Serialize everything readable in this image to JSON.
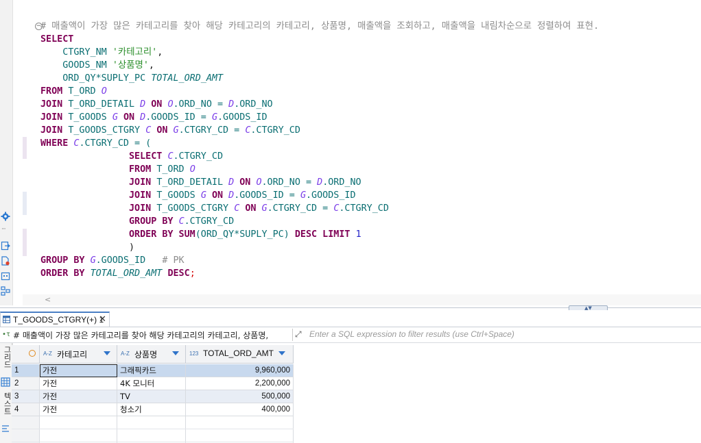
{
  "editor": {
    "lines": [
      [
        {
          "t": "# 매출액이 가장 많은 카테고리를 찾아 해당 카테고리의 카테고리, 상품명, 매출액을 조회하고, 매출액을 내림차순으로 정렬하여 표현.",
          "c": "cm"
        }
      ],
      [
        {
          "t": "SELECT",
          "c": "kw"
        }
      ],
      [
        {
          "t": "    CTGRY_NM ",
          "c": "col"
        },
        {
          "t": "'카테고리'",
          "c": "str"
        },
        {
          "t": ",",
          "c": ""
        }
      ],
      [
        {
          "t": "    GOODS_NM ",
          "c": "col"
        },
        {
          "t": "'상품명'",
          "c": "str"
        },
        {
          "t": ",",
          "c": ""
        }
      ],
      [
        {
          "t": "    ORD_QY*SUPLY_PC ",
          "c": "col"
        },
        {
          "t": "TOTAL_ORD_AMT",
          "c": "ital"
        }
      ],
      [
        {
          "t": "FROM ",
          "c": "kw"
        },
        {
          "t": "T_ORD ",
          "c": "col"
        },
        {
          "t": "O",
          "c": "al"
        }
      ],
      [
        {
          "t": "JOIN ",
          "c": "kw"
        },
        {
          "t": "T_ORD_DETAIL ",
          "c": "col"
        },
        {
          "t": "D ",
          "c": "al"
        },
        {
          "t": "ON ",
          "c": "kw"
        },
        {
          "t": "O",
          "c": "al"
        },
        {
          "t": ".ORD_NO = ",
          "c": "col"
        },
        {
          "t": "D",
          "c": "al"
        },
        {
          "t": ".ORD_NO",
          "c": "col"
        }
      ],
      [
        {
          "t": "JOIN ",
          "c": "kw"
        },
        {
          "t": "T_GOODS ",
          "c": "col"
        },
        {
          "t": "G ",
          "c": "al"
        },
        {
          "t": "ON ",
          "c": "kw"
        },
        {
          "t": "D",
          "c": "al"
        },
        {
          "t": ".GOODS_ID = ",
          "c": "col"
        },
        {
          "t": "G",
          "c": "al"
        },
        {
          "t": ".GOODS_ID",
          "c": "col"
        }
      ],
      [
        {
          "t": "JOIN ",
          "c": "kw"
        },
        {
          "t": "T_GOODS_CTGRY ",
          "c": "col"
        },
        {
          "t": "C ",
          "c": "al"
        },
        {
          "t": "ON ",
          "c": "kw"
        },
        {
          "t": "G",
          "c": "al"
        },
        {
          "t": ".CTGRY_CD = ",
          "c": "col"
        },
        {
          "t": "C",
          "c": "al"
        },
        {
          "t": ".CTGRY_CD",
          "c": "col"
        }
      ],
      [
        {
          "t": "WHERE ",
          "c": "kw"
        },
        {
          "t": "C",
          "c": "al"
        },
        {
          "t": ".CTGRY_CD = (",
          "c": "col"
        }
      ],
      [
        {
          "t": "                ",
          "c": ""
        },
        {
          "t": "SELECT ",
          "c": "kw"
        },
        {
          "t": "C",
          "c": "al"
        },
        {
          "t": ".CTGRY_CD",
          "c": "col"
        }
      ],
      [
        {
          "t": "                ",
          "c": ""
        },
        {
          "t": "FROM ",
          "c": "kw"
        },
        {
          "t": "T_ORD ",
          "c": "col"
        },
        {
          "t": "O",
          "c": "al"
        }
      ],
      [
        {
          "t": "                ",
          "c": ""
        },
        {
          "t": "JOIN ",
          "c": "kw"
        },
        {
          "t": "T_ORD_DETAIL ",
          "c": "col"
        },
        {
          "t": "D ",
          "c": "al"
        },
        {
          "t": "ON ",
          "c": "kw"
        },
        {
          "t": "O",
          "c": "al"
        },
        {
          "t": ".ORD_NO = ",
          "c": "col"
        },
        {
          "t": "D",
          "c": "al"
        },
        {
          "t": ".ORD_NO",
          "c": "col"
        }
      ],
      [
        {
          "t": "                ",
          "c": ""
        },
        {
          "t": "JOIN ",
          "c": "kw"
        },
        {
          "t": "T_GOODS ",
          "c": "col"
        },
        {
          "t": "G ",
          "c": "al"
        },
        {
          "t": "ON ",
          "c": "kw"
        },
        {
          "t": "D",
          "c": "al"
        },
        {
          "t": ".GOODS_ID = ",
          "c": "col"
        },
        {
          "t": "G",
          "c": "al"
        },
        {
          "t": ".GOODS_ID",
          "c": "col"
        }
      ],
      [
        {
          "t": "                ",
          "c": ""
        },
        {
          "t": "JOIN ",
          "c": "kw"
        },
        {
          "t": "T_GOODS_CTGRY ",
          "c": "col"
        },
        {
          "t": "C ",
          "c": "al"
        },
        {
          "t": "ON ",
          "c": "kw"
        },
        {
          "t": "G",
          "c": "al"
        },
        {
          "t": ".CTGRY_CD = ",
          "c": "col"
        },
        {
          "t": "C",
          "c": "al"
        },
        {
          "t": ".CTGRY_CD",
          "c": "col"
        }
      ],
      [
        {
          "t": "                ",
          "c": ""
        },
        {
          "t": "GROUP BY ",
          "c": "kw"
        },
        {
          "t": "C",
          "c": "al"
        },
        {
          "t": ".CTGRY_CD",
          "c": "col"
        }
      ],
      [
        {
          "t": "                ",
          "c": ""
        },
        {
          "t": "ORDER BY SUM",
          "c": "kw"
        },
        {
          "t": "(ORD_QY*SUPLY_PC) ",
          "c": "col"
        },
        {
          "t": "DESC LIMIT ",
          "c": "kw"
        },
        {
          "t": "1",
          "c": "num"
        }
      ],
      [
        {
          "t": "                )",
          "c": ""
        }
      ],
      [
        {
          "t": "GROUP BY ",
          "c": "kw"
        },
        {
          "t": "G",
          "c": "al"
        },
        {
          "t": ".GOODS_ID   ",
          "c": "col"
        },
        {
          "t": "# PK",
          "c": "cm"
        }
      ],
      [
        {
          "t": "ORDER BY ",
          "c": "kw"
        },
        {
          "t": "TOTAL_ORD_AMT ",
          "c": "ital"
        },
        {
          "t": "DESC",
          "c": "kw"
        },
        {
          "t": ";",
          "c": "semi"
        }
      ]
    ]
  },
  "results": {
    "tab_label": "T_GOODS_CTGRY(+) 1",
    "filter_query": "# 매출액이 가장 많은 카테고리를 찾아 해당 카테고리의 카테고리, 상품명,",
    "filter_placeholder": "Enter a SQL expression to filter results (use Ctrl+Space)",
    "side_label_grid": "그리드",
    "side_label_text": "텍스트",
    "columns": [
      {
        "type": "A-Z",
        "name": "카테고리"
      },
      {
        "type": "A-Z",
        "name": "상품명"
      },
      {
        "type": "123",
        "name": "TOTAL_ORD_AMT"
      }
    ],
    "rows": [
      {
        "n": "1",
        "cat": "가전",
        "name": "그래픽카드",
        "amt": "9,960,000"
      },
      {
        "n": "2",
        "cat": "가전",
        "name": "4K 모니터",
        "amt": "2,200,000"
      },
      {
        "n": "3",
        "cat": "가전",
        "name": "TV",
        "amt": "500,000"
      },
      {
        "n": "4",
        "cat": "가전",
        "name": "청소기",
        "amt": "400,000"
      }
    ],
    "colors": {
      "selected_row": "#c8d9ee",
      "alt_row": "#e8edf5",
      "header_bg": "#f2f3f5"
    }
  }
}
